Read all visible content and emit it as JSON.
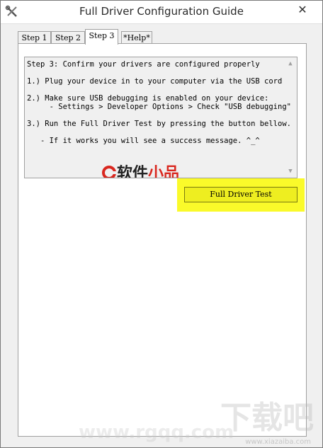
{
  "window": {
    "title": "Full Driver Configuration Guide",
    "close_glyph": "✕"
  },
  "tabs": [
    {
      "label": "Step 1"
    },
    {
      "label": "Step 2"
    },
    {
      "label": "Step 3",
      "active": true
    },
    {
      "label": "*Help*"
    }
  ],
  "instructions": {
    "lines": [
      "Step 3: Confirm your drivers are configured properly",
      "1.) Plug your device in to your computer via the USB cord",
      "2.) Make sure USB debugging is enabled on your device:",
      "     - Settings > Developer Options > Check \"USB debugging\"",
      "3.) Run the Full Driver Test by pressing the button bellow.",
      "   - If it works you will see a success message. ^_^"
    ]
  },
  "actions": {
    "full_driver_test_label": "Full Driver Test"
  },
  "watermark": {
    "brand": "软件小品",
    "brand_part1": "软件",
    "brand_part2": "小品",
    "download": "下载吧",
    "url": "www.rgqq.com",
    "small": "www.xiazaiba.com"
  },
  "colors": {
    "highlight": "#fafa2a",
    "button": "#eeee20",
    "watermark_red": "#d9271f"
  }
}
